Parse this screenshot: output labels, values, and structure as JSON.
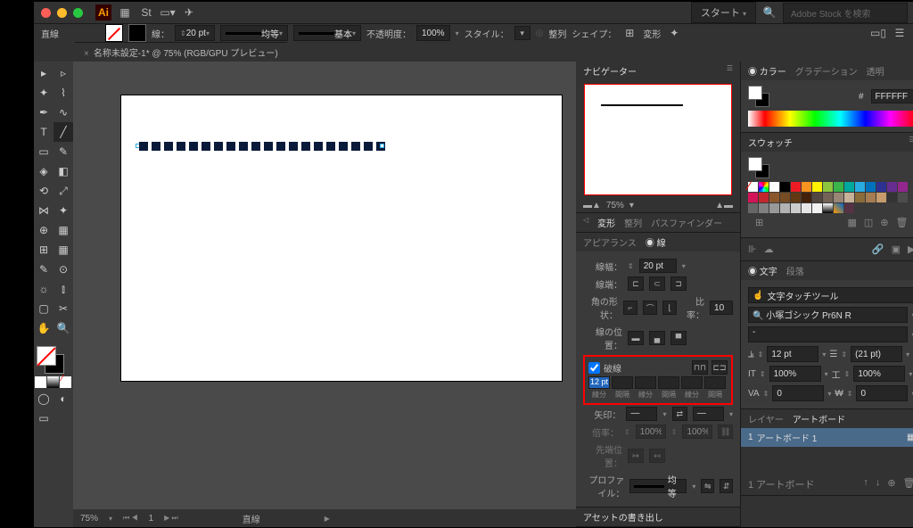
{
  "title_bar": {
    "start_label": "スタート",
    "search_placeholder": "Adobe Stock を検索"
  },
  "options": {
    "tool_name": "直線",
    "stroke_label": "線：",
    "stroke_weight": "20 pt",
    "uniform": "均等",
    "basic": "基本",
    "opacity_label": "不透明度：",
    "opacity": "100%",
    "style_label": "スタイル：",
    "align_label": "整列",
    "shape_label": "シェイプ：",
    "transform_label": "変形"
  },
  "tab": {
    "filename": "名称未設定-1* @ 75% (RGB/GPU プレビュー)"
  },
  "status": {
    "zoom": "75%",
    "page": "1",
    "tool": "直線"
  },
  "navigator": {
    "title": "ナビゲーター",
    "zoom": "75%"
  },
  "transform_panel": {
    "tab1": "変形",
    "tab2": "整列",
    "tab3": "パスファインダー"
  },
  "appearance": {
    "title": "アピアランス",
    "stroke": "線"
  },
  "stroke_panel": {
    "weight_label": "線幅：",
    "weight": "20 pt",
    "cap_label": "線端：",
    "corner_label": "角の形状：",
    "ratio_label": "比率：",
    "ratio": "10",
    "align_label": "線の位置：",
    "dash_label": "破線",
    "dash_value": "12 pt",
    "dash_col1": "線分",
    "dash_col2": "間隔",
    "arrow_label": "矢印：",
    "scale_label": "倍率：",
    "scale1": "100%",
    "scale2": "100%",
    "tip_label": "先端位置：",
    "profile_label": "プロファイル：",
    "profile_val": "均等"
  },
  "asset": {
    "title": "アセットの書き出し"
  },
  "color_panel": {
    "tab1": "カラー",
    "tab2": "グラデーション",
    "tab3": "透明",
    "hex": "FFFFFF",
    "hash": "#"
  },
  "swatches": {
    "title": "スウォッチ"
  },
  "char": {
    "tab1": "文字",
    "tab2": "段落",
    "touch_tool": "文字タッチツール",
    "font": "小塚ゴシック Pr6N R",
    "style": "-",
    "size": "12 pt",
    "leading": "(21 pt)",
    "kerning": "100%",
    "tracking": "100%",
    "vscale": "0",
    "baseline": "0"
  },
  "layers": {
    "tab1": "レイヤー",
    "tab2": "アートボード",
    "artboard1": "アートボード 1",
    "count_label": "1 アートボード",
    "num": "1"
  }
}
